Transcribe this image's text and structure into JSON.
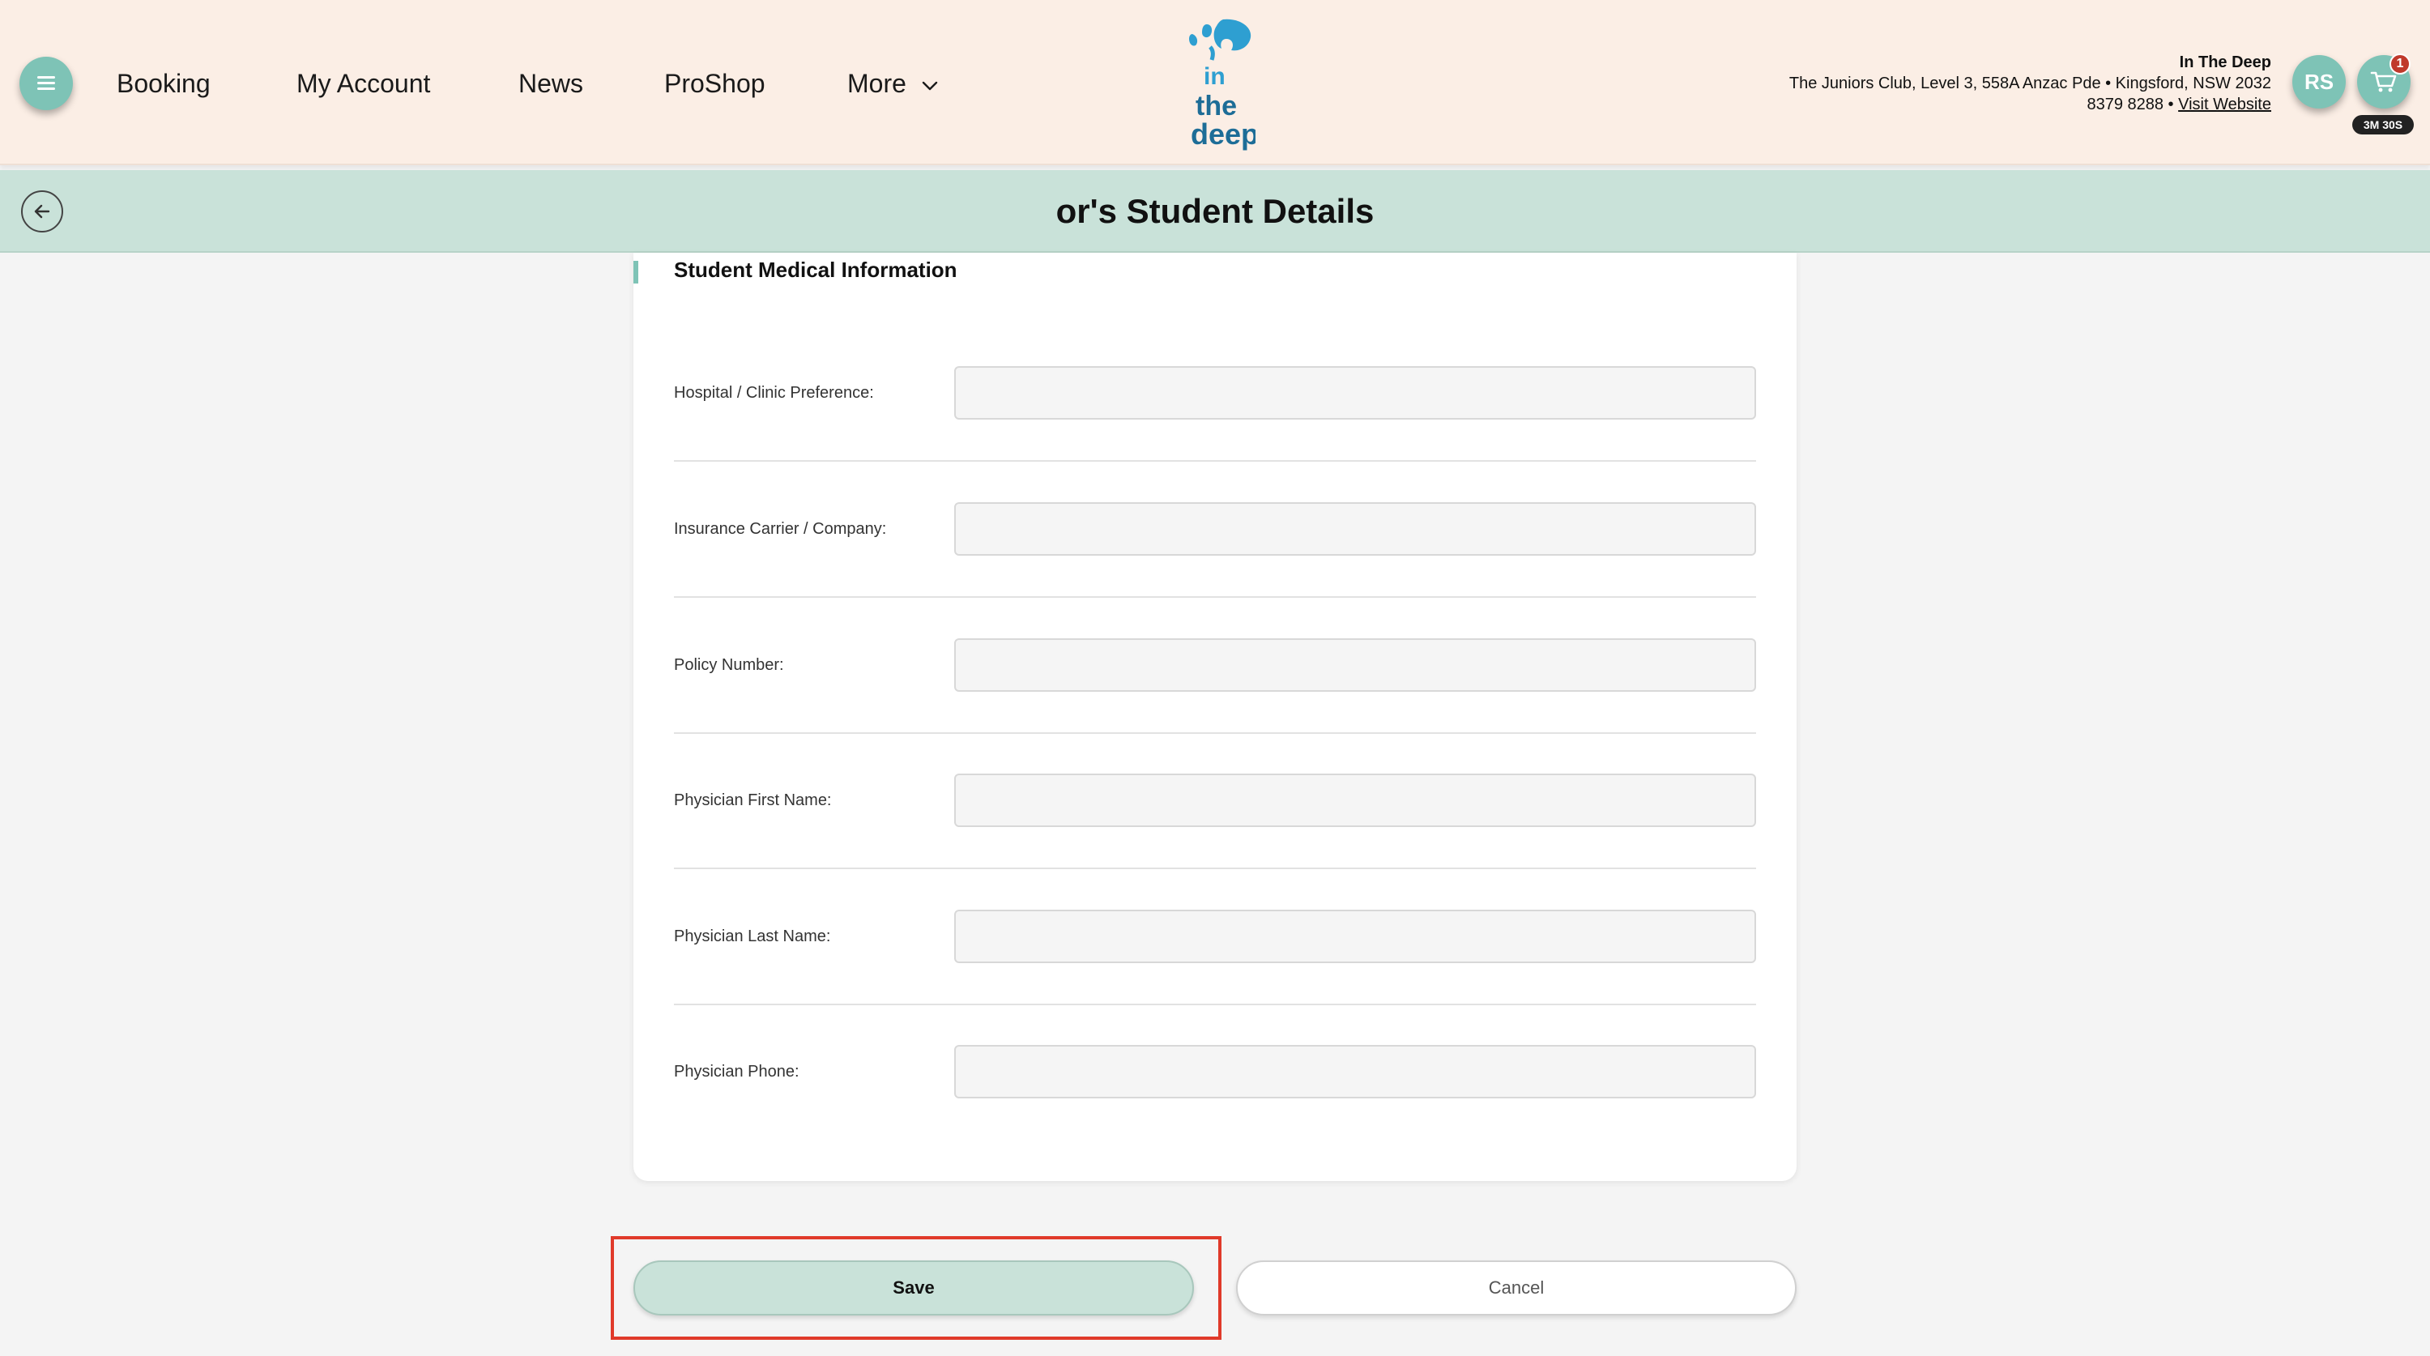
{
  "header": {
    "nav": [
      {
        "label": "Booking"
      },
      {
        "label": "My Account"
      },
      {
        "label": "News"
      },
      {
        "label": "ProShop"
      },
      {
        "label": "More"
      }
    ],
    "logo_text": [
      "in",
      "the",
      "deep"
    ],
    "club": {
      "name": "In The Deep",
      "address": "The Juniors Club, Level 3, 558A Anzac Pde • Kingsford, NSW 2032",
      "phone": "8379 8288 •",
      "visit_link": "Visit Website"
    },
    "avatar_initials": "RS",
    "cart_count": "1",
    "timer": "3M 30S"
  },
  "titlebar": {
    "title": "or's Student Details"
  },
  "section": {
    "title": "Student Medical Information"
  },
  "fields": [
    {
      "label": "Hospital / Clinic Preference:",
      "value": ""
    },
    {
      "label": "Insurance Carrier / Company:",
      "value": ""
    },
    {
      "label": "Policy Number:",
      "value": ""
    },
    {
      "label": "Physician First Name:",
      "value": ""
    },
    {
      "label": "Physician Last Name:",
      "value": ""
    },
    {
      "label": "Physician Phone:",
      "value": ""
    }
  ],
  "actions": {
    "save_label": "Save",
    "cancel_label": "Cancel"
  },
  "colors": {
    "header_bg": "#fbeee5",
    "accent": "#7ec3b6",
    "titlebar_bg": "#c9e2d9",
    "highlight": "#e03a2a",
    "logo_blue": "#2e9fd1"
  }
}
